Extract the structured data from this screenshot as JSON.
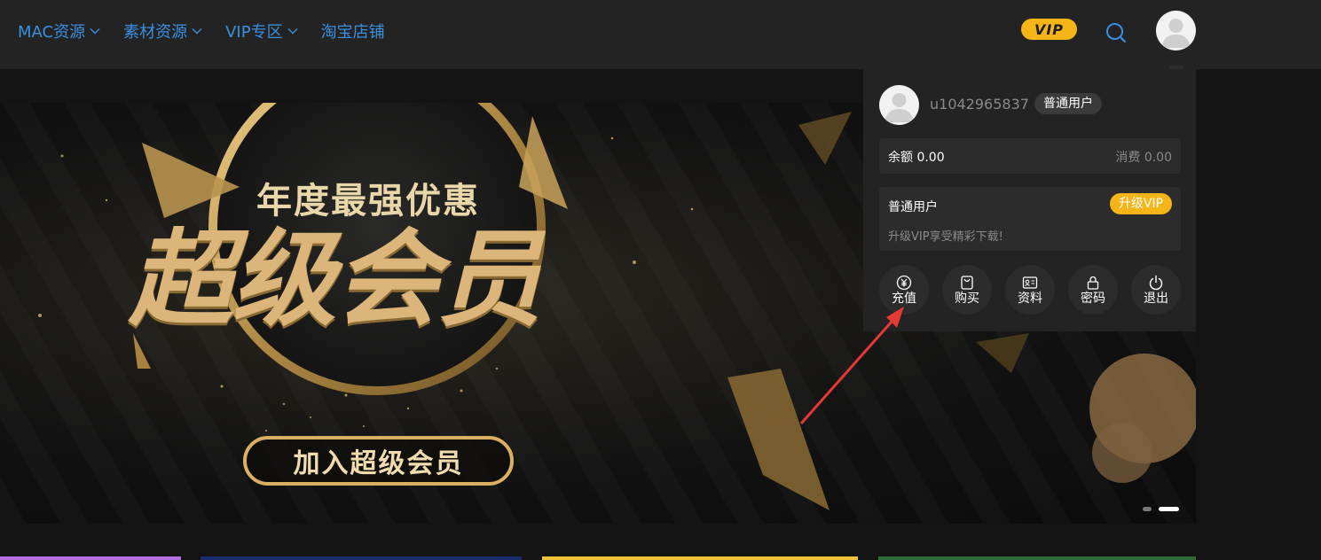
{
  "nav": {
    "items": [
      {
        "label": "MAC资源",
        "has_dropdown": true
      },
      {
        "label": "素材资源",
        "has_dropdown": true
      },
      {
        "label": "VIP专区",
        "has_dropdown": true
      },
      {
        "label": "淘宝店铺",
        "has_dropdown": false
      }
    ]
  },
  "header": {
    "vip_badge": "VIP",
    "search_icon": "search-icon",
    "avatar_icon": "user-avatar"
  },
  "banner": {
    "subtitle": "年度最强优惠",
    "title": "超级会员",
    "cta": "加入超级会员",
    "slides": 2,
    "active_slide": 2
  },
  "user_panel": {
    "username": "u1042965837",
    "role": "普通用户",
    "balance_label": "余额 0.00",
    "spent_label": "消费 0.00",
    "vip_level": "普通用户",
    "upgrade_label": "升级VIP",
    "vip_desc": "升级VIP享受精彩下载!",
    "actions": [
      {
        "label": "充值",
        "icon": "yuan-icon"
      },
      {
        "label": "购买",
        "icon": "shopping-bag-icon"
      },
      {
        "label": "资料",
        "icon": "id-card-icon"
      },
      {
        "label": "密码",
        "icon": "lock-icon"
      },
      {
        "label": "退出",
        "icon": "power-icon"
      }
    ]
  },
  "colors": {
    "nav_link": "#3b8fe0",
    "vip_gold": "#f5b417",
    "header_bg": "#232323",
    "page_bg": "#141414",
    "panel_box": "#2c2c2c",
    "annotation_arrow": "#e53935"
  }
}
